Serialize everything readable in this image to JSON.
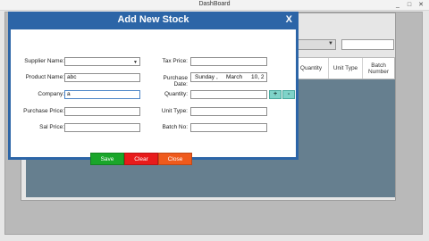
{
  "dashboard": {
    "title": "DashBoard",
    "minimize_glyph": "_",
    "maximize_glyph": "□",
    "close_glyph": "✕"
  },
  "background_grid": {
    "columns": [
      "Quantity",
      "Unit Type",
      "Batch Number"
    ],
    "grid_color": "#667f8f"
  },
  "modal": {
    "title": "Add New Stock",
    "close_label": "X",
    "header_color": "#2c65a7",
    "left_fields": [
      {
        "label": "Supplier Name:",
        "value": "",
        "type": "select"
      },
      {
        "label": "Product Name:",
        "value": "abc",
        "type": "text"
      },
      {
        "label": "Company:",
        "value": "a",
        "type": "text"
      },
      {
        "label": "Purchase Price:",
        "value": "",
        "type": "text"
      },
      {
        "label": "Sal Price:",
        "value": "",
        "type": "text"
      }
    ],
    "right_fields": {
      "tax_price": {
        "label": "Tax Price:",
        "value": ""
      },
      "purchase_date": {
        "label": "Purchase Date:",
        "weekday": "Sunday",
        "separator": ",",
        "month": "March",
        "rest": "10, 2"
      },
      "quantity": {
        "label": "Quantity:",
        "value": ""
      },
      "unit_type": {
        "label": "Unit Type:",
        "value": ""
      },
      "batch_no": {
        "label": "Batch No:",
        "value": ""
      }
    },
    "stepper": {
      "plus": "+",
      "minus": "-"
    },
    "buttons": {
      "save": {
        "label": "Save",
        "color": "#1aa62a"
      },
      "clear": {
        "label": "Clear",
        "color": "#e81b1b"
      },
      "close": {
        "label": "Close",
        "color": "#ef5a1c"
      }
    }
  }
}
